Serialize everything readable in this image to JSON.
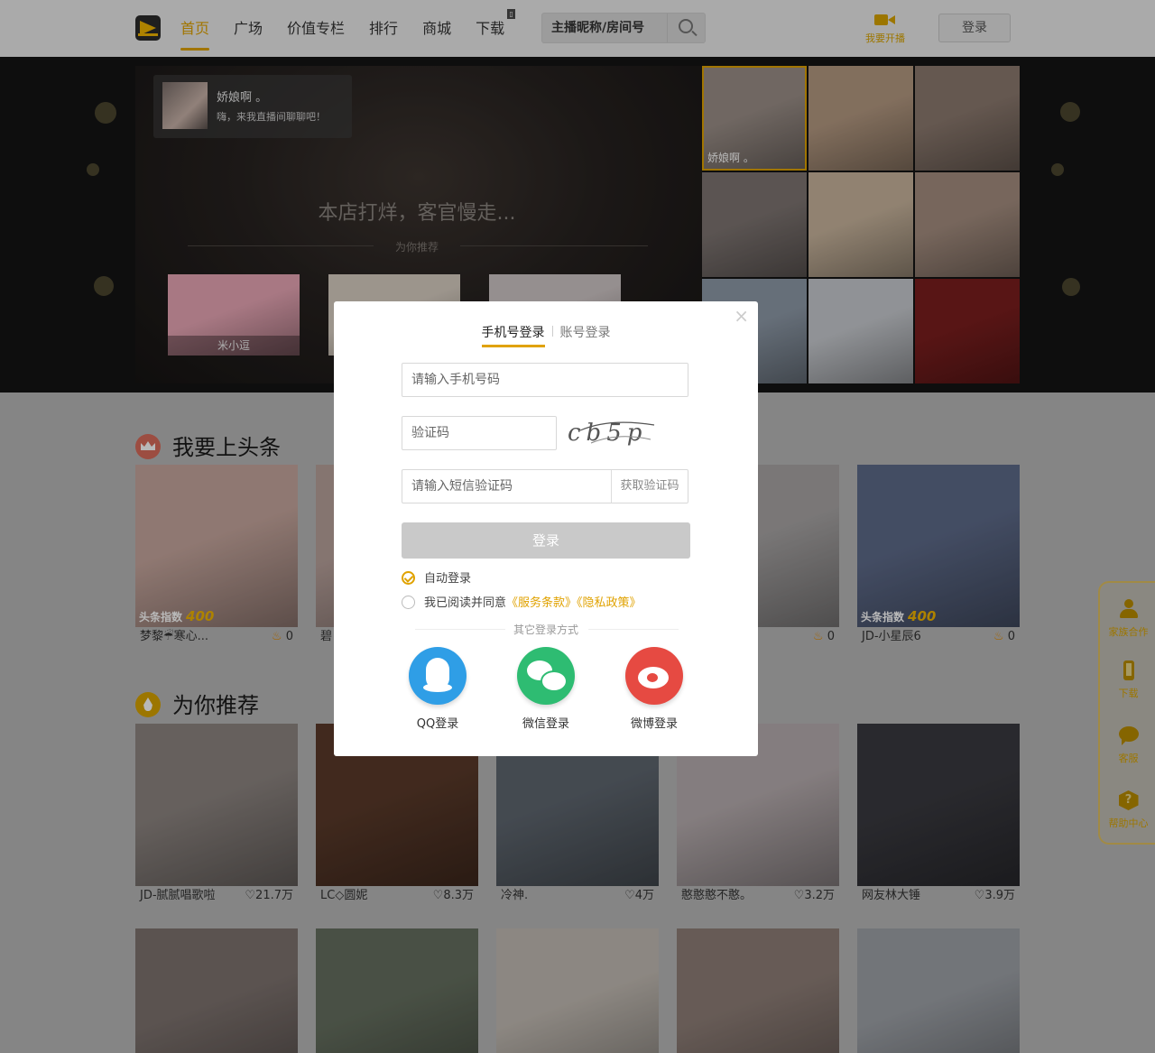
{
  "header": {
    "nav": [
      "首页",
      "广场",
      "价值专栏",
      "排行",
      "商城",
      "下载"
    ],
    "search_placeholder": "主播昵称/房间号",
    "live_label": "我要开播",
    "login_label": "登录"
  },
  "hero": {
    "host_name": "娇娘啊 。",
    "host_message": "嗨，来我直播间聊聊吧！",
    "offline_text": "本店打烊，客官慢走...",
    "recommend_label": "为你推荐",
    "recommend_thumbs": [
      {
        "name": "米小逗",
        "color": "#e9a7b6"
      },
      {
        "name": "",
        "color": "#d9cfc3"
      },
      {
        "name": "",
        "color": "#cfc6c6"
      }
    ],
    "grid": [
      {
        "name": "娇娘啊 。",
        "color": "#9b8f88"
      },
      {
        "name": "",
        "color": "#b59a82"
      },
      {
        "name": "",
        "color": "#8c7a6f"
      },
      {
        "name": "",
        "color": "#7e7572"
      },
      {
        "name": "",
        "color": "#c9b59d"
      },
      {
        "name": "",
        "color": "#a58e80"
      },
      {
        "name": "",
        "color": "#8e9aa8"
      },
      {
        "name": "",
        "color": "#c8cbd0"
      },
      {
        "name": "",
        "color": "#7a1e1e"
      }
    ]
  },
  "headline": {
    "title": "我要上头条",
    "index_label": "头条指数",
    "cards": [
      {
        "name": "梦黎☔寒心...",
        "index": "400",
        "stat": "0",
        "color": "#c7a79e"
      },
      {
        "name": "碧",
        "index": "",
        "stat": "",
        "color": "#b9a29c"
      },
      {
        "name": "",
        "index": "0",
        "stat": "0",
        "color": "#a9a6a6"
      },
      {
        "name": "JD-小星辰6",
        "index": "400",
        "stat": "0",
        "color": "#5e6b8a"
      }
    ]
  },
  "recommend": {
    "title": "为你推荐",
    "cards": [
      {
        "name": "JD-腻腻唱歌啦",
        "stat": "21.7万",
        "color": "#8e8682"
      },
      {
        "name": "LC◇圆妮",
        "stat": "8.3万",
        "color": "#5a3a2a"
      },
      {
        "name": "冷神.",
        "stat": "4万",
        "color": "#5f6770"
      },
      {
        "name": "憨憨憨不憨。",
        "stat": "3.2万",
        "color": "#b8aeb0"
      },
      {
        "name": "网友林大锤",
        "stat": "3.9万",
        "color": "#3a3a40"
      }
    ],
    "row2": [
      "#7f7470",
      "#667060",
      "#c3bcb4",
      "#8f7f78",
      "#9ea2a8"
    ]
  },
  "sidebar": [
    "家族合作",
    "下载",
    "客服",
    "帮助中心"
  ],
  "modal": {
    "tab_phone": "手机号登录",
    "tab_account": "账号登录",
    "phone_placeholder": "请输入手机号码",
    "captcha_placeholder": "验证码",
    "sms_placeholder": "请输入短信验证码",
    "sms_button": "获取验证码",
    "submit": "登录",
    "auto_login": "自动登录",
    "agree_prefix": "我已阅读并同意",
    "terms": "《服务条款》",
    "privacy": "《隐私政策》",
    "other_methods": "其它登录方式",
    "qq": "QQ登录",
    "wechat": "微信登录",
    "weibo": "微博登录",
    "captcha_text": "cb5p",
    "accent": "#e0a200"
  }
}
